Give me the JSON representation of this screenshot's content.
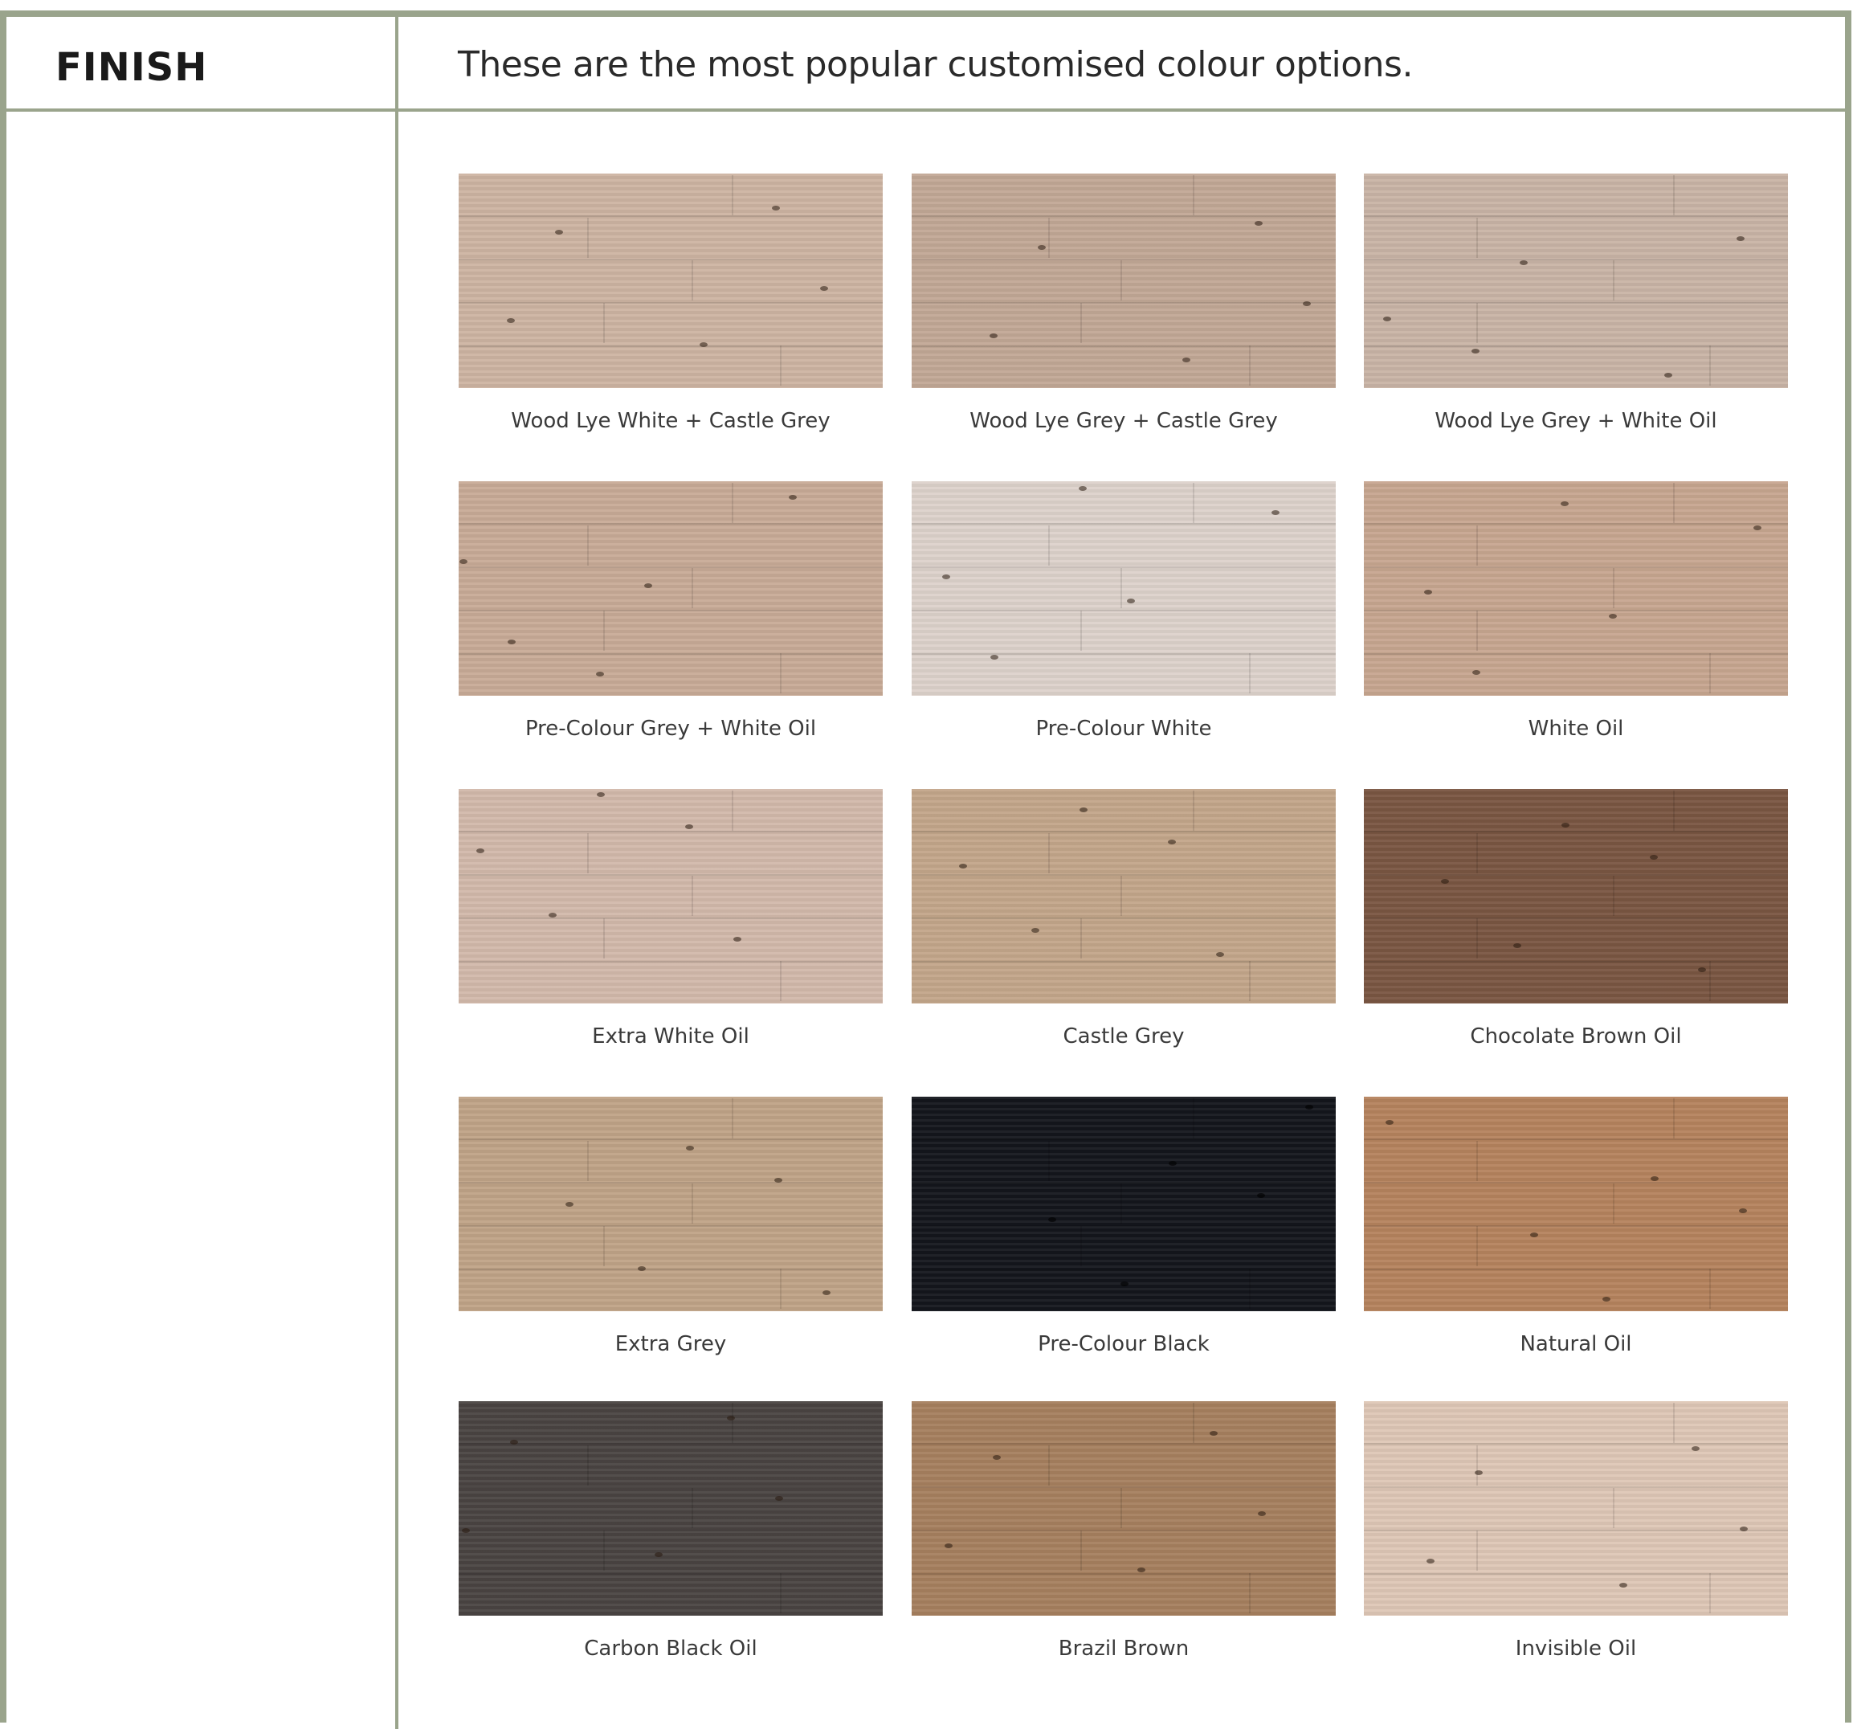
{
  "section_label": "FINISH",
  "header": "These are the most popular customised colour options.",
  "border_color": "#9aa48c",
  "swatches": [
    {
      "name": "Wood Lye White + Castle Grey",
      "color": "#cdb4a2"
    },
    {
      "name": "Wood Lye Grey + Castle Grey",
      "color": "#c2a896"
    },
    {
      "name": "Wood Lye Grey + White Oil",
      "color": "#c9b4a6"
    },
    {
      "name": "Pre-Colour Grey + White Oil",
      "color": "#c8ab97"
    },
    {
      "name": "Pre-Colour White",
      "color": "#ddd2cb"
    },
    {
      "name": "White Oil",
      "color": "#c7a690"
    },
    {
      "name": "Extra White Oil",
      "color": "#d2b9ab"
    },
    {
      "name": "Castle Grey",
      "color": "#c3a68a"
    },
    {
      "name": "Chocolate Brown Oil",
      "color": "#7a5642"
    },
    {
      "name": "Extra Grey",
      "color": "#c0a387"
    },
    {
      "name": "Pre-Colour Black",
      "color": "#14161c"
    },
    {
      "name": "Natural Oil",
      "color": "#b5835e"
    },
    {
      "name": "Carbon Black Oil",
      "color": "#4a4442"
    },
    {
      "name": "Brazil Brown",
      "color": "#a6805f"
    },
    {
      "name": "Invisible Oil",
      "color": "#dec7b6"
    }
  ]
}
